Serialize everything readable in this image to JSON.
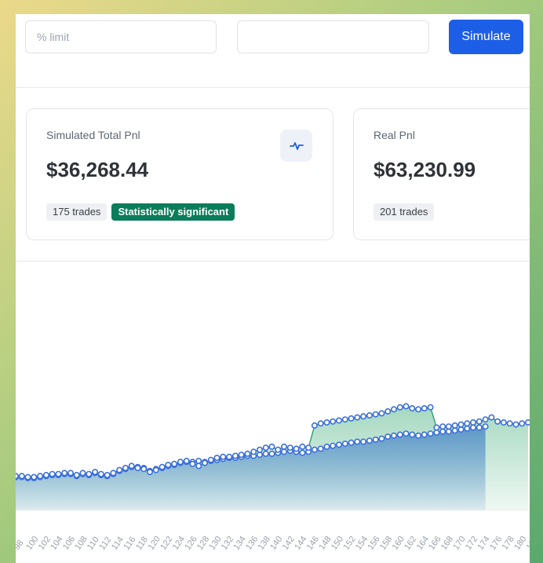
{
  "controls": {
    "limit_placeholder": "% limit",
    "second_value": "",
    "simulate_label": "Simulate"
  },
  "cards": {
    "simulated": {
      "label": "Simulated Total Pnl",
      "value": "$36,268.44",
      "trades": "175 trades",
      "significance": "Statistically significant"
    },
    "real": {
      "label": "Real Pnl",
      "value": "$63,230.99",
      "trades": "201 trades"
    }
  },
  "icons": {
    "stat_card_icon": "activity-pulse-icon"
  },
  "colors": {
    "accent": "#1d5ee6",
    "badge_green": "#0b7d5a",
    "series_stroke": "#3b6fd8",
    "fill_green": "#8fcfb0",
    "fill_blue": "#4f8bc9"
  },
  "chart_data": {
    "type": "area",
    "x": [
      98,
      99,
      100,
      101,
      102,
      103,
      104,
      105,
      106,
      107,
      108,
      109,
      110,
      111,
      112,
      113,
      114,
      115,
      116,
      117,
      118,
      119,
      120,
      121,
      122,
      123,
      124,
      125,
      126,
      127,
      128,
      129,
      130,
      131,
      132,
      133,
      134,
      135,
      136,
      137,
      138,
      139,
      140,
      141,
      142,
      143,
      144,
      145,
      146,
      147,
      148,
      149,
      150,
      151,
      152,
      153,
      154,
      155,
      156,
      157,
      158,
      159,
      160,
      161,
      162,
      163,
      164,
      165,
      166,
      167,
      168,
      169,
      170,
      171,
      172,
      173,
      174,
      175,
      176,
      177,
      178,
      179,
      180,
      181,
      182
    ],
    "x_tick_labels": [
      "98",
      "100",
      "102",
      "104",
      "106",
      "108",
      "110",
      "112",
      "114",
      "116",
      "118",
      "120",
      "122",
      "124",
      "126",
      "128",
      "130",
      "132",
      "134",
      "136",
      "138",
      "140",
      "142",
      "144",
      "146",
      "148",
      "150",
      "152",
      "154",
      "156",
      "158",
      "160",
      "162",
      "164",
      "166",
      "168",
      "170",
      "172",
      "174",
      "176",
      "178",
      "180",
      "182"
    ],
    "series": [
      {
        "values": [
          25,
          25,
          24,
          24,
          25,
          26,
          27,
          27,
          28,
          28,
          26,
          28,
          27,
          29,
          27,
          26,
          28,
          31,
          33,
          35,
          35,
          34,
          31,
          33,
          34,
          36,
          37,
          39,
          40,
          40,
          41,
          40,
          41,
          42,
          43,
          44,
          44,
          45,
          46,
          46,
          47,
          48,
          48,
          49,
          50,
          51,
          50,
          49,
          50,
          52,
          53,
          55,
          56,
          57,
          58,
          59,
          60,
          60,
          61,
          62,
          63,
          65,
          66,
          67,
          68,
          67,
          66,
          67,
          68,
          69,
          70,
          70,
          71,
          72,
          73,
          74,
          74,
          75,
          76,
          77,
          78,
          79,
          80,
          81,
          82
        ],
        "x_end": 175
      },
      {
        "values": [
          26,
          26,
          25,
          25,
          26,
          27,
          28,
          28,
          29,
          29,
          27,
          29,
          28,
          30,
          28,
          27,
          29,
          32,
          34,
          36,
          34,
          33,
          30,
          32,
          35,
          37,
          38,
          40,
          41,
          38,
          36,
          39,
          42,
          44,
          45,
          45,
          46,
          47,
          48,
          50,
          52,
          54,
          55,
          52,
          55,
          54,
          53,
          55,
          54,
          76,
          78,
          79,
          80,
          81,
          82,
          83,
          84,
          85,
          86,
          87,
          88,
          90,
          92,
          94,
          95,
          93,
          92,
          93,
          94,
          74,
          75,
          75,
          76,
          77,
          78,
          79,
          80,
          82,
          84,
          80,
          79,
          78,
          77,
          78,
          79
        ],
        "x_end": 182
      }
    ],
    "title": "",
    "xlabel": "",
    "ylabel": "",
    "grid": false,
    "legend": "none"
  }
}
